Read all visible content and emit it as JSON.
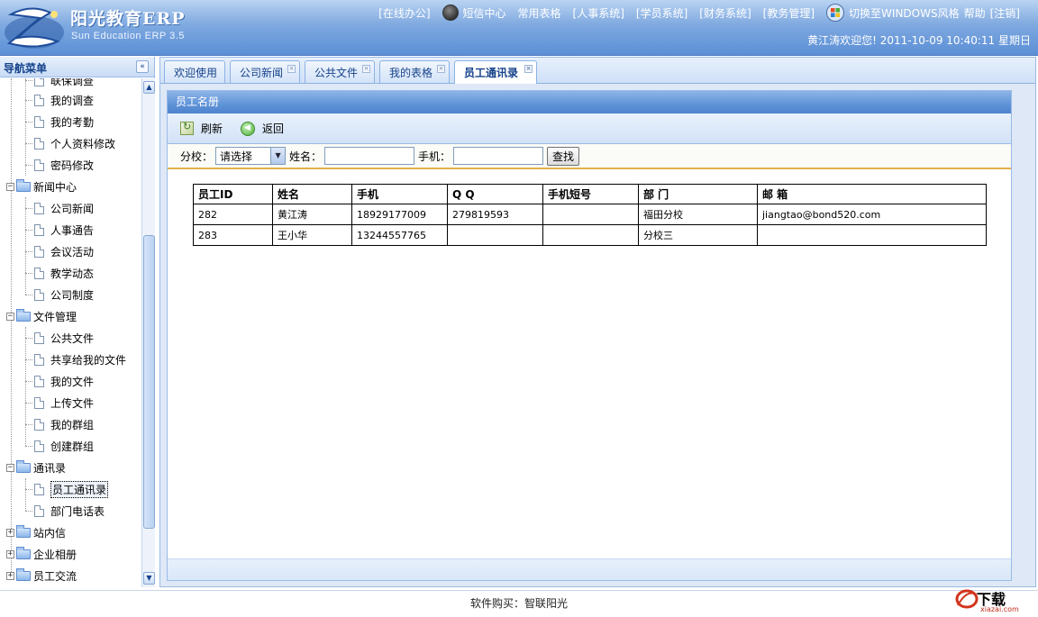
{
  "header": {
    "title": "阳光教育ERP",
    "subtitle": "Sun Education ERP 3.5",
    "nav": {
      "online_office": "[在线办公]",
      "sms_center": "短信中心",
      "common_forms": "常用表格",
      "hr_system": "[人事系统]",
      "student_system": "[学员系统]",
      "finance_system": "[财务系统]",
      "academic_management": "[教务管理]",
      "switch_windows": "切换至WINDOWS风格",
      "help": "帮助",
      "logout": "[注销]"
    },
    "welcome": "黄江涛欢迎您! 2011-10-09 10:40:11 星期日"
  },
  "sidebar": {
    "title": "导航菜单",
    "collapse_symbol": "«",
    "items": {
      "cut_top": "联保调查",
      "my_survey": "我的调查",
      "my_attendance": "我的考勤",
      "profile_edit": "个人资料修改",
      "password_edit": "密码修改",
      "news_center": "新闻中心",
      "company_news": "公司新闻",
      "hr_notice": "人事通告",
      "meetings": "会议活动",
      "teaching_news": "教学动态",
      "company_rules": "公司制度",
      "file_management": "文件管理",
      "public_files": "公共文件",
      "shared_with_me": "共享给我的文件",
      "my_files": "我的文件",
      "upload_files": "上传文件",
      "my_groups": "我的群组",
      "create_group": "创建群组",
      "address_book": "通讯录",
      "staff_directory": "员工通讯录",
      "dept_phones": "部门电话表",
      "site_messages": "站内信",
      "company_album": "企业相册",
      "staff_exchange": "员工交流"
    },
    "expanded_symbol": "−",
    "collapsed_symbol": "+"
  },
  "tabs": [
    {
      "label": "欢迎使用",
      "active": false,
      "closable": false
    },
    {
      "label": "公司新闻",
      "active": false,
      "closable": true
    },
    {
      "label": "公共文件",
      "active": false,
      "closable": true
    },
    {
      "label": "我的表格",
      "active": false,
      "closable": true
    },
    {
      "label": "员工通讯录",
      "active": true,
      "closable": true
    }
  ],
  "tab_close_symbol": "×",
  "panel": {
    "title": "员工名册",
    "toolbar": {
      "refresh": "刷新",
      "back": "返回"
    },
    "search": {
      "branch_label": "分校：",
      "branch_value": "请选择",
      "name_label": "姓名：",
      "name_value": "",
      "phone_label": "手机：",
      "phone_value": "",
      "submit": "查找"
    },
    "table": {
      "columns": [
        "员工ID",
        "姓名",
        "手机",
        "Q Q",
        "手机短号",
        "部 门",
        "邮 箱"
      ],
      "rows": [
        [
          "282",
          "黄江涛",
          "18929177009",
          "279819593",
          "",
          "福田分校",
          "jiangtao@bond520.com"
        ],
        [
          "283",
          "王小华",
          "13244557765",
          "",
          "",
          "分校三",
          ""
        ]
      ]
    }
  },
  "footer": {
    "text": "软件购买：智联阳光"
  },
  "watermark": {
    "text": "下载",
    "url": "xiazai.com"
  },
  "colors": {
    "header_blue": "#5b8fd6",
    "panel_title_blue": "#4d83cd",
    "accent_gold": "#e0b24a",
    "tree_text": "#000000"
  }
}
